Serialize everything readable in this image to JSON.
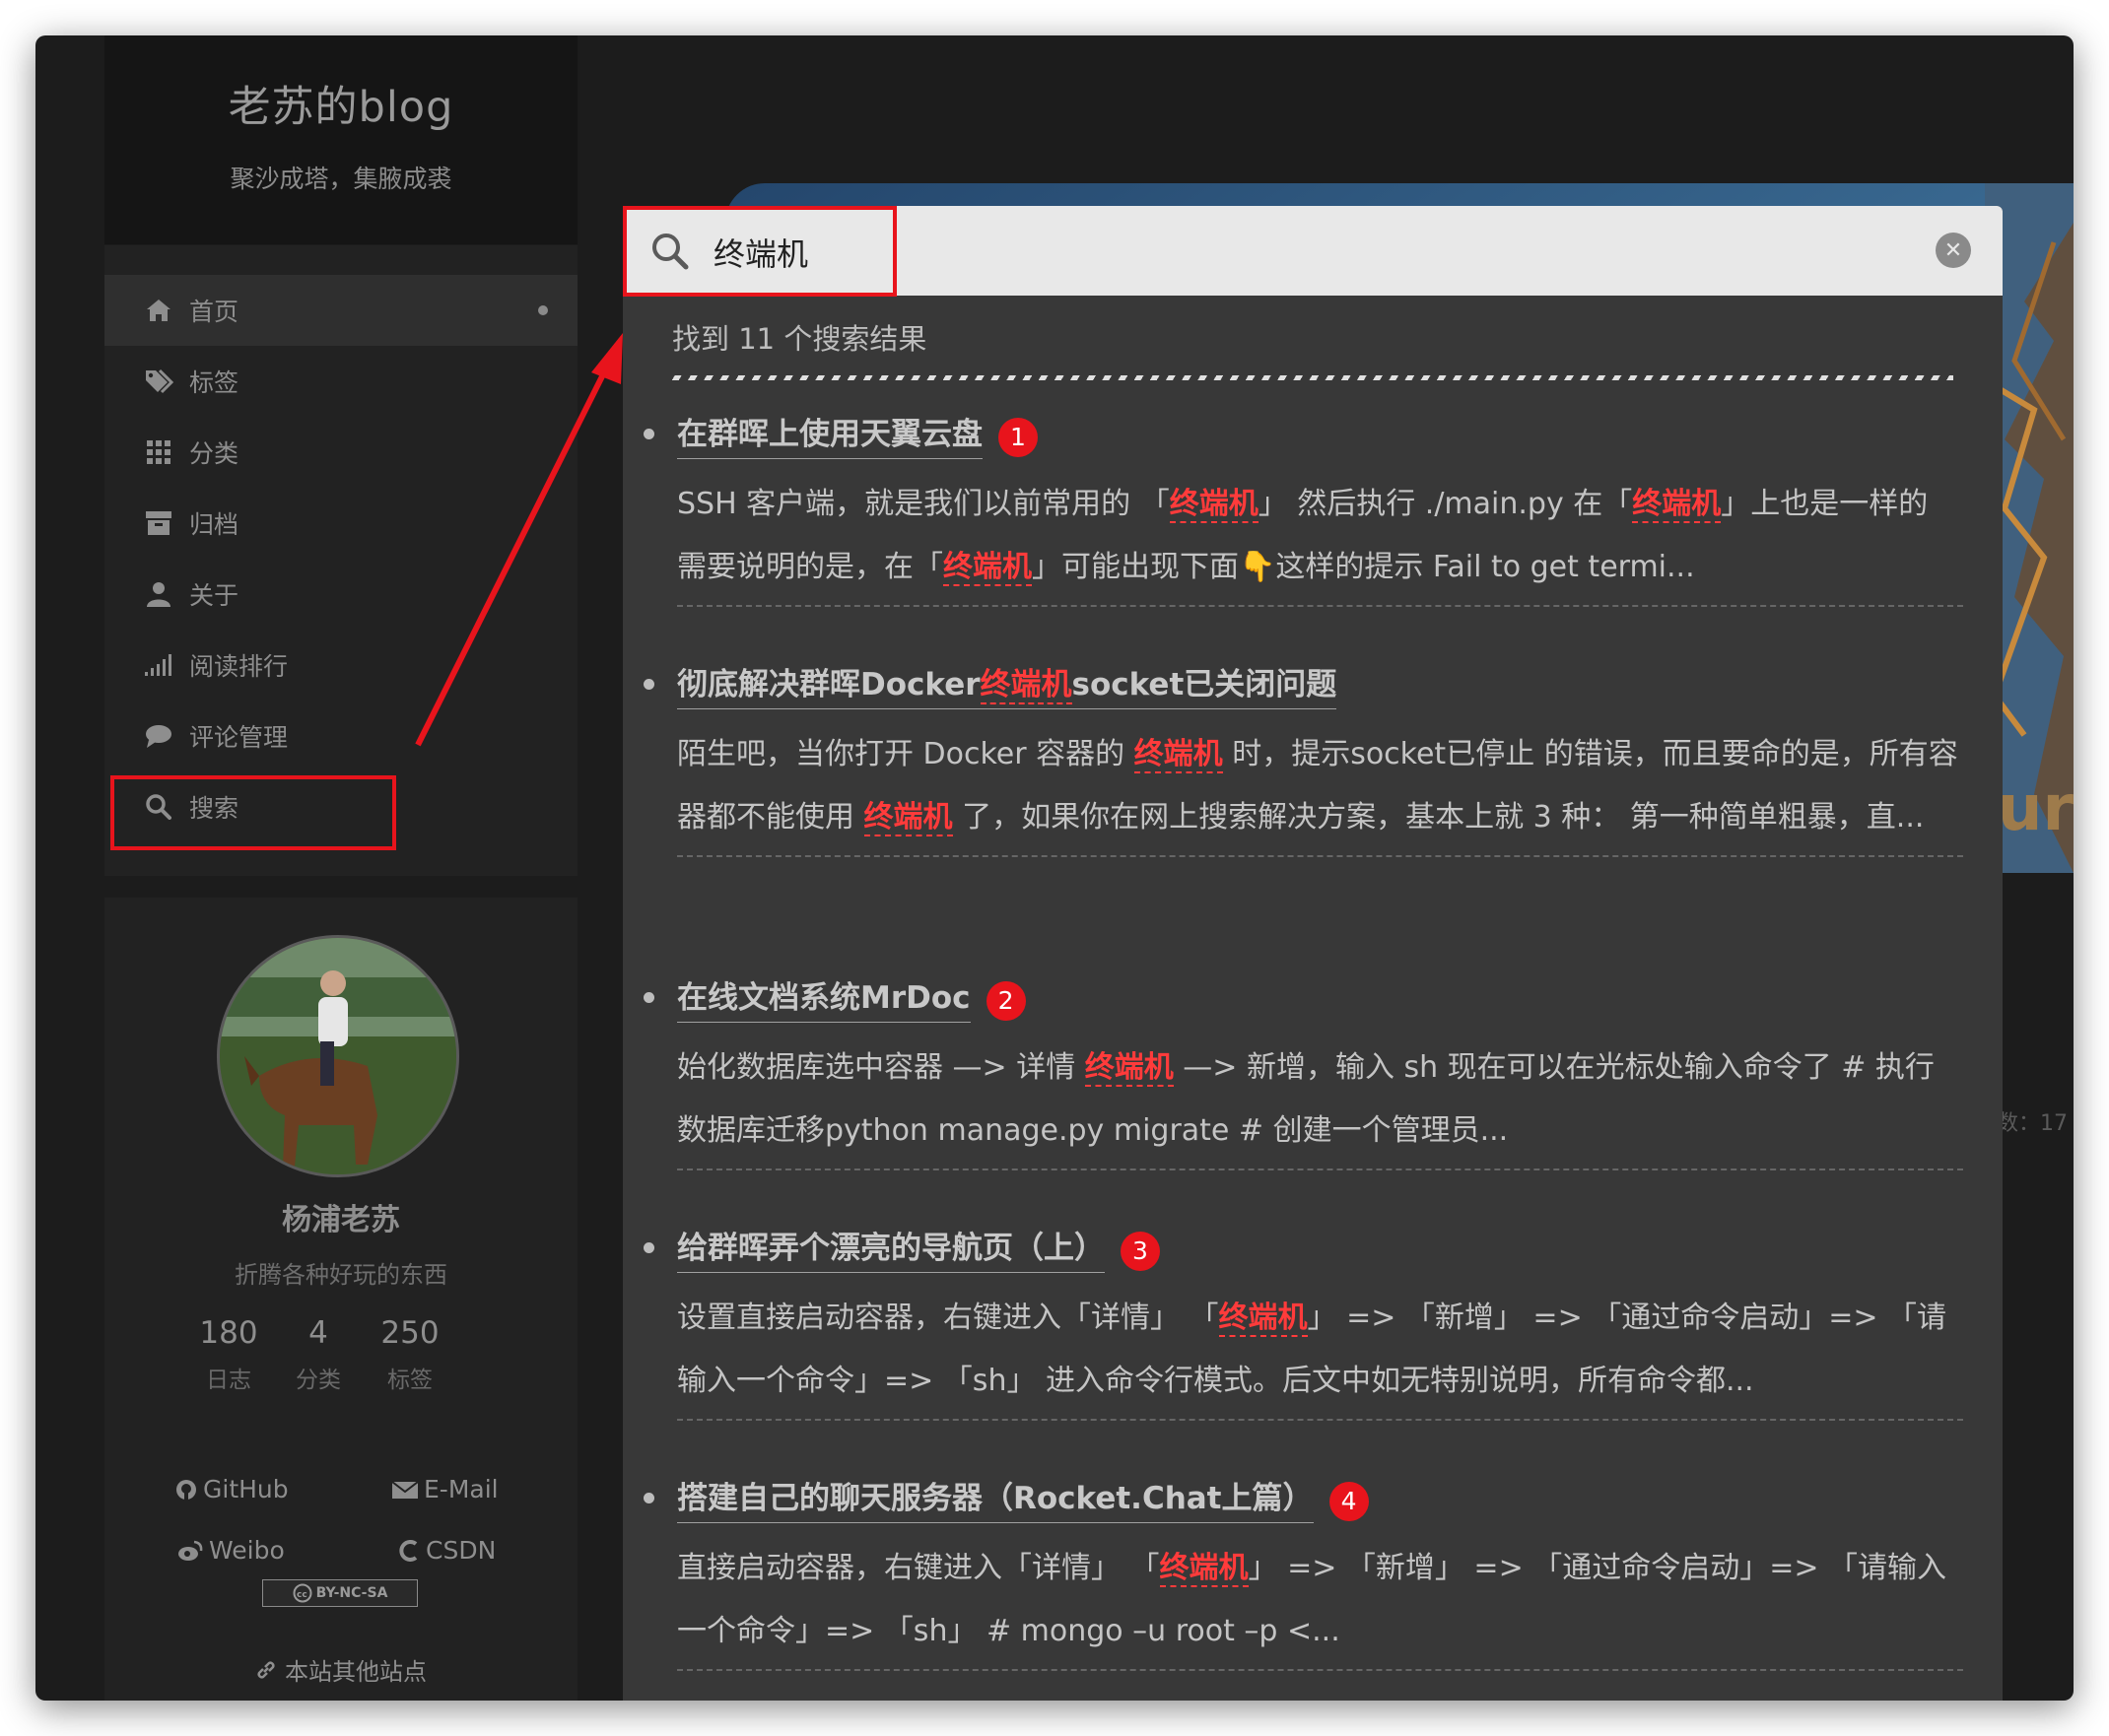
{
  "sidebar": {
    "site_title": "老苏的blog",
    "site_subtitle": "聚沙成塔，集腋成裘",
    "menu": [
      {
        "label": "首页",
        "icon": "home-icon",
        "active": true
      },
      {
        "label": "标签",
        "icon": "tags-icon"
      },
      {
        "label": "分类",
        "icon": "grid-icon"
      },
      {
        "label": "归档",
        "icon": "archive-icon"
      },
      {
        "label": "关于",
        "icon": "user-icon"
      },
      {
        "label": "阅读排行",
        "icon": "signal-icon"
      },
      {
        "label": "评论管理",
        "icon": "comment-icon"
      },
      {
        "label": "搜索",
        "icon": "search-icon"
      }
    ],
    "author": {
      "name": "杨浦老苏",
      "description": "折腾各种好玩的东西",
      "stats": [
        {
          "value": "180",
          "label": "日志"
        },
        {
          "value": "4",
          "label": "分类"
        },
        {
          "value": "250",
          "label": "标签"
        }
      ],
      "links": [
        {
          "label": "GitHub",
          "icon": "github-icon"
        },
        {
          "label": "E-Mail",
          "icon": "envelope-icon"
        },
        {
          "label": "Weibo",
          "icon": "weibo-icon"
        },
        {
          "label": "CSDN",
          "icon": "csdn-icon"
        }
      ],
      "license": "BY-NC-SA",
      "other_sites": "本站其他站点"
    }
  },
  "background": {
    "banner_glyph": "ur",
    "stat_fragment": "数：17"
  },
  "search": {
    "query": "终端机",
    "result_count_text": "找到 11 个搜索结果",
    "results": [
      {
        "title": "在群晖上使用天翼云盘",
        "badge": "1",
        "excerpt": [
          {
            "t": "SSH 客户端，就是我们以前常用的 「"
          },
          {
            "t": "终端机",
            "hl": true
          },
          {
            "t": "」 然后执行 ./main.py 在「"
          },
          {
            "t": "终端机",
            "hl": true
          },
          {
            "t": "」上也是一样的 需要说明的是，在「"
          },
          {
            "t": "终端机",
            "hl": true
          },
          {
            "t": "」可能出现下面👇这样的提示 Fail to get termi..."
          }
        ]
      },
      {
        "title_parts": [
          {
            "t": "彻底解决群晖Docker"
          },
          {
            "t": "终端机",
            "hl": true
          },
          {
            "t": "socket已关闭问题"
          }
        ],
        "badge": "",
        "excerpt": [
          {
            "t": "陌生吧，当你打开 Docker 容器的 "
          },
          {
            "t": "终端机",
            "hl": true
          },
          {
            "t": " 时，提示socket已停止 的错误，而且要命的是，所有容器都不能使用 "
          },
          {
            "t": "终端机",
            "hl": true
          },
          {
            "t": " 了，如果你在网上搜索解决方案，基本上就 3 种： 第一种简单粗暴，直..."
          }
        ]
      },
      {
        "title": "在线文档系统MrDoc",
        "badge": "2",
        "excerpt": [
          {
            "t": "始化数据库选中容器 —> 详情 "
          },
          {
            "t": "终端机",
            "hl": true
          },
          {
            "t": " —> 新增，输入 sh 现在可以在光标处输入命令了 # 执行数据库迁移python manage.py migrate # 创建一个管理员..."
          }
        ]
      },
      {
        "title": "给群晖弄个漂亮的导航页（上）",
        "badge": "3",
        "excerpt": [
          {
            "t": "设置直接启动容器，右键进入「详情」 「"
          },
          {
            "t": "终端机",
            "hl": true
          },
          {
            "t": "」 => 「新增」 => 「通过命令启动」=> 「请输入一个命令」=> 「sh」 进入命令行模式。后文中如无特别说明，所有命令都..."
          }
        ]
      },
      {
        "title": "搭建自己的聊天服务器（Rocket.Chat上篇）",
        "badge": "4",
        "excerpt": [
          {
            "t": "直接启动容器，右键进入「详情」 「"
          },
          {
            "t": "终端机",
            "hl": true
          },
          {
            "t": "」 => 「新增」 => 「通过命令启动」=> 「请输入一个命令」=> 「sh」 # mongo –u root –p <..."
          }
        ]
      }
    ]
  },
  "colors": {
    "highlight": "#ff3b3b",
    "annotation": "#e8141c",
    "popup_bg": "#383838",
    "sidebar_bg": "#222222"
  }
}
